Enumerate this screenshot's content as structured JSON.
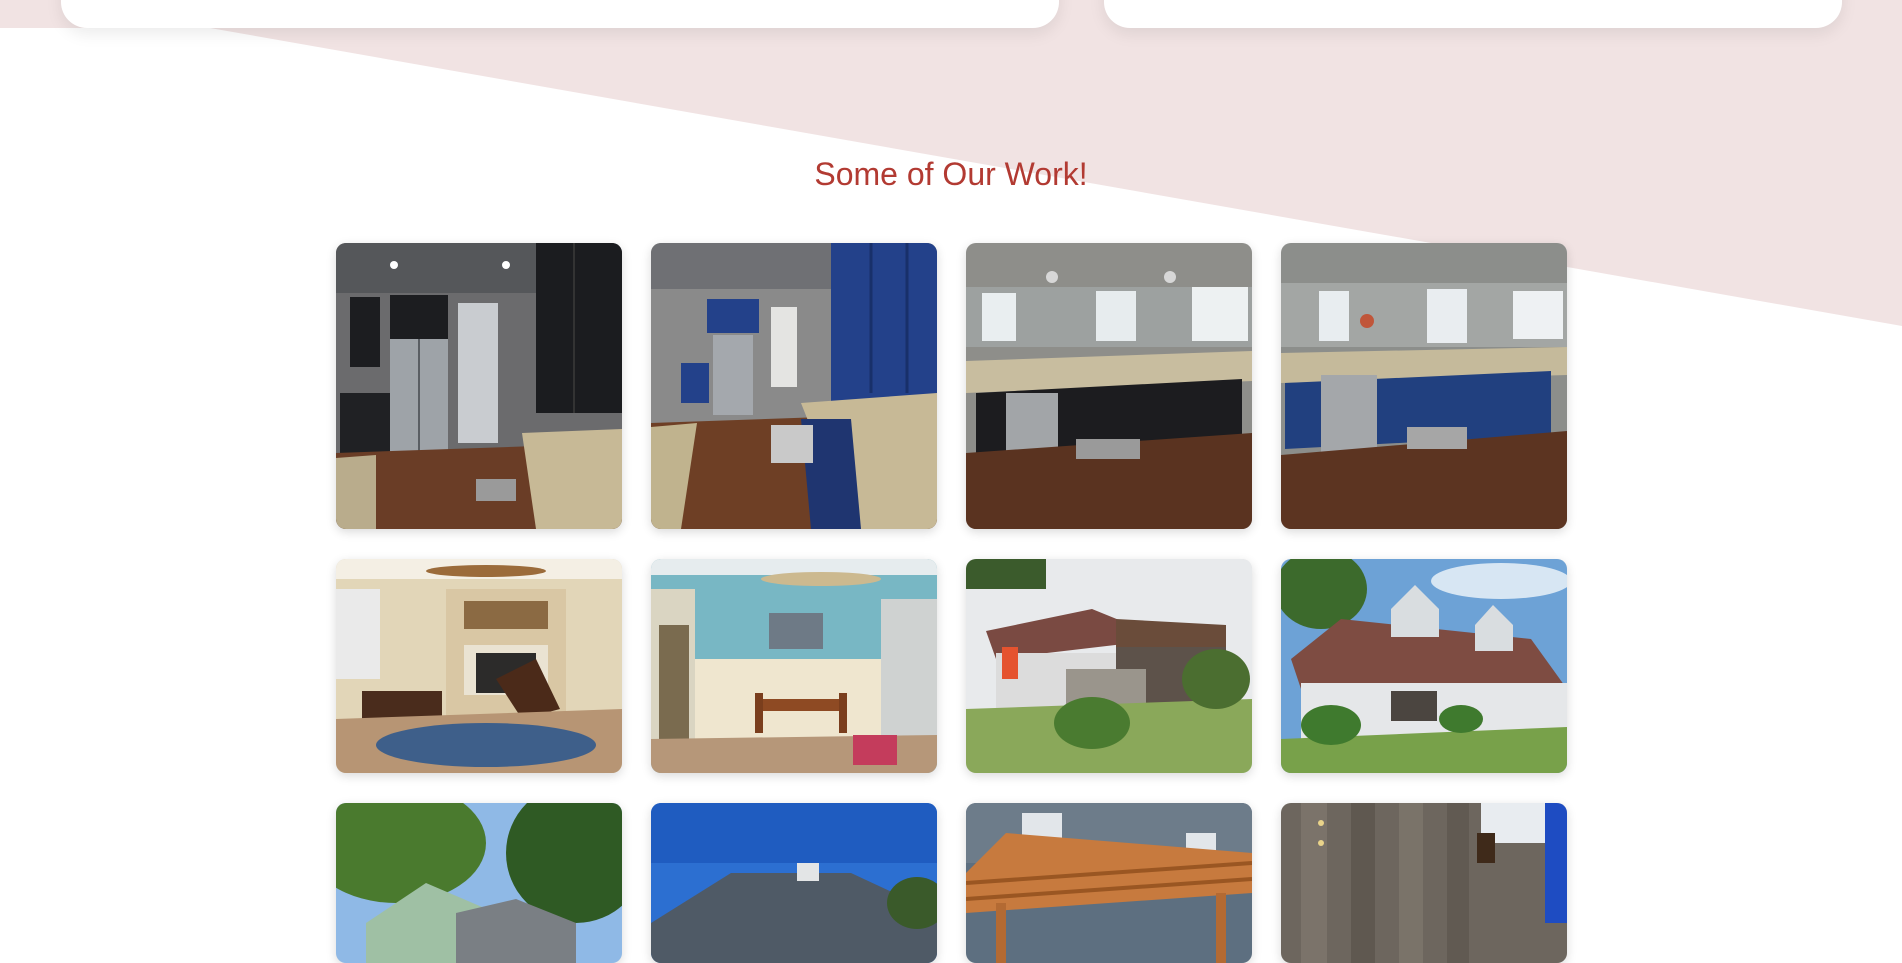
{
  "section": {
    "title": "Some of Our Work!"
  },
  "colors": {
    "accent": "#b23a32",
    "band": "#f1e3e3"
  },
  "gallery": {
    "photos": [
      {
        "subject": "kitchen-black-cabinets-fridge"
      },
      {
        "subject": "kitchen-blue-cabinets-fridge"
      },
      {
        "subject": "kitchen-black-island"
      },
      {
        "subject": "kitchen-blue-island"
      },
      {
        "subject": "living-room-fireplace"
      },
      {
        "subject": "dining-room-teal"
      },
      {
        "subject": "house-back-screened-porch"
      },
      {
        "subject": "house-front-dormers"
      },
      {
        "subject": "house-exterior-trees"
      },
      {
        "subject": "house-roof-blue-sky"
      },
      {
        "subject": "pergola-deck"
      },
      {
        "subject": "wood-deck-boards"
      }
    ]
  }
}
